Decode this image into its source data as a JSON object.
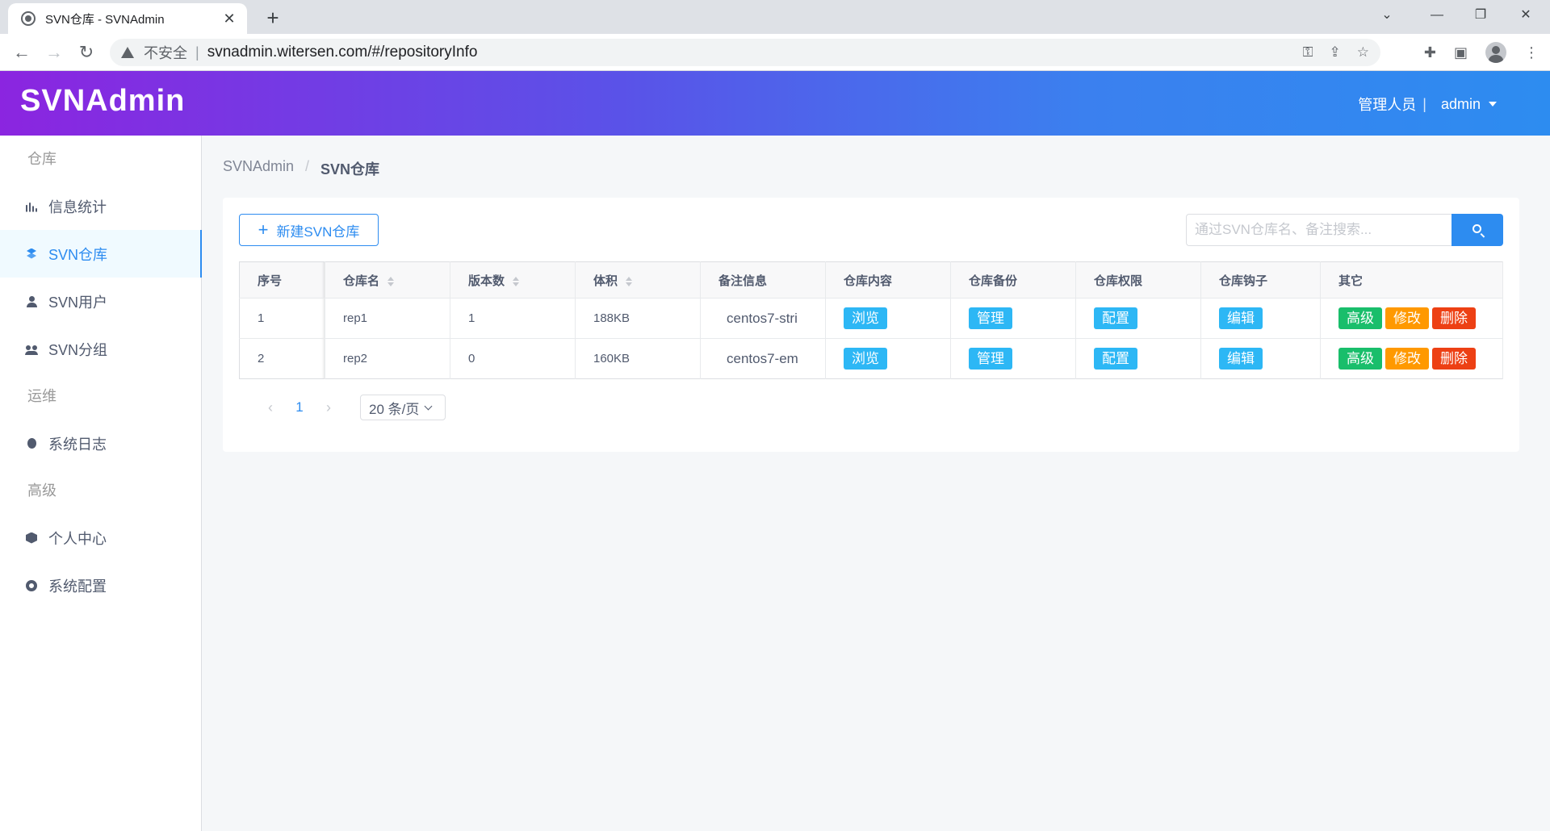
{
  "browser": {
    "tab_title": "SVN仓库 - SVNAdmin",
    "security_label": "不安全",
    "url": "svnadmin.witersen.com/#/repositoryInfo"
  },
  "header": {
    "logo": "SVNAdmin",
    "role": "管理人员",
    "divider": "|",
    "user": "admin"
  },
  "sidebar": {
    "groups": [
      {
        "title": "仓库",
        "items": [
          {
            "label": "信息统计",
            "icon": "bar-chart-icon"
          },
          {
            "label": "SVN仓库",
            "icon": "layers-icon",
            "active": true
          },
          {
            "label": "SVN用户",
            "icon": "person-icon"
          },
          {
            "label": "SVN分组",
            "icon": "people-icon"
          }
        ]
      },
      {
        "title": "运维",
        "items": [
          {
            "label": "系统日志",
            "icon": "bug-icon"
          }
        ]
      },
      {
        "title": "高级",
        "items": [
          {
            "label": "个人中心",
            "icon": "cube-icon"
          },
          {
            "label": "系统配置",
            "icon": "gear-icon"
          }
        ]
      }
    ]
  },
  "breadcrumb": {
    "root": "SVNAdmin",
    "separator": "/",
    "current": "SVN仓库"
  },
  "toolbar": {
    "new_repo_label": "新建SVN仓库",
    "search_placeholder": "通过SVN仓库名、备注搜索..."
  },
  "table": {
    "columns": [
      "序号",
      "仓库名",
      "版本数",
      "体积",
      "备注信息",
      "仓库内容",
      "仓库备份",
      "仓库权限",
      "仓库钩子",
      "其它"
    ],
    "rows": [
      {
        "index": "1",
        "name": "rep1",
        "revisions": "1",
        "size": "188KB",
        "note": "centos7-stri",
        "browse": "浏览",
        "backup": "管理",
        "auth": "配置",
        "hooks": "编辑",
        "advanced": "高级",
        "edit": "修改",
        "delete": "删除"
      },
      {
        "index": "2",
        "name": "rep2",
        "revisions": "0",
        "size": "160KB",
        "note": "centos7-em",
        "browse": "浏览",
        "backup": "管理",
        "auth": "配置",
        "hooks": "编辑",
        "advanced": "高级",
        "edit": "修改",
        "delete": "删除"
      }
    ]
  },
  "pagination": {
    "current_page": "1",
    "page_size": "20 条/页"
  },
  "colors": {
    "primary": "#2d8cf0",
    "tag_blue": "#2db7f5",
    "tag_green": "#19be6b",
    "tag_orange": "#ff9900",
    "tag_red": "#ed4014",
    "header_gradient_start": "#8b25e0",
    "header_gradient_end": "#2d8cf0"
  }
}
